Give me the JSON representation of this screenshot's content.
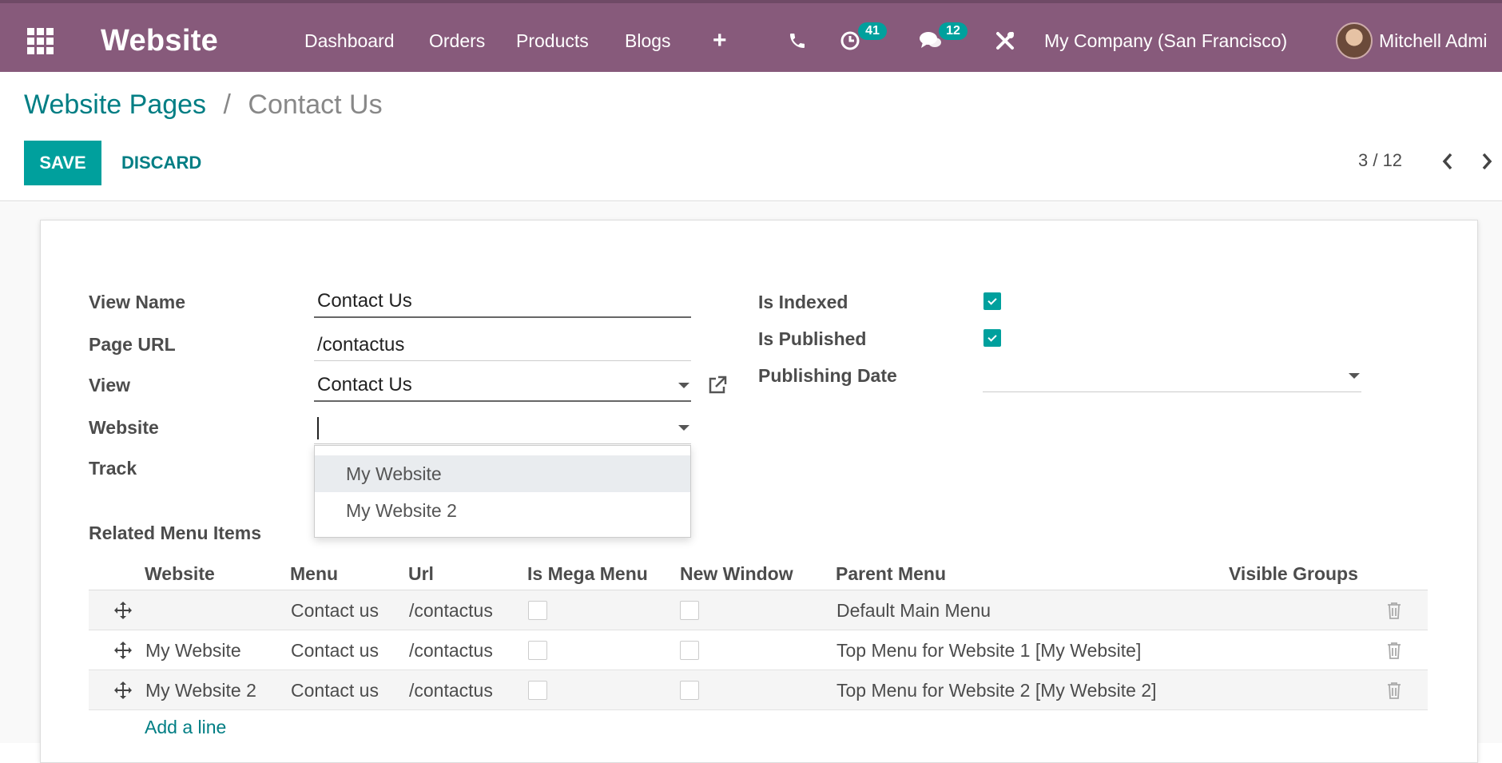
{
  "navbar": {
    "app_name": "Website",
    "menu": [
      "Dashboard",
      "Orders",
      "Products",
      "Blogs"
    ],
    "plus": "+",
    "activity_count": "41",
    "message_count": "12",
    "company": "My Company (San Francisco)",
    "user": "Mitchell Admi",
    "icons": [
      "apps-grid-icon",
      "phone-icon",
      "clock-icon",
      "chat-icon",
      "debug-tools-icon"
    ]
  },
  "breadcrumb": {
    "parent": "Website Pages",
    "separator": "/",
    "current": "Contact Us"
  },
  "actions": {
    "save": "SAVE",
    "discard": "DISCARD"
  },
  "pager": {
    "value": "3 / 12"
  },
  "form": {
    "labels": {
      "view_name": "View Name",
      "page_url": "Page URL",
      "view": "View",
      "website": "Website",
      "track": "Track",
      "is_indexed": "Is Indexed",
      "is_published": "Is Published",
      "publishing_date": "Publishing Date"
    },
    "values": {
      "view_name": "Contact Us",
      "page_url": "/contactus",
      "view": "Contact Us",
      "website": "",
      "publishing_date": "",
      "is_indexed": true,
      "is_published": true
    },
    "website_dropdown": [
      "My Website",
      "My Website 2"
    ]
  },
  "menu_items": {
    "title": "Related Menu Items",
    "columns": [
      "Website",
      "Menu",
      "Url",
      "Is Mega Menu",
      "New Window",
      "Parent Menu",
      "Visible Groups"
    ],
    "rows": [
      {
        "website": "",
        "menu": "Contact us",
        "url": "/contactus",
        "mega": false,
        "new_window": false,
        "parent": "Default Main Menu"
      },
      {
        "website": "My Website",
        "menu": "Contact us",
        "url": "/contactus",
        "mega": false,
        "new_window": false,
        "parent": "Top Menu for Website 1 [My Website]"
      },
      {
        "website": "My Website 2",
        "menu": "Contact us",
        "url": "/contactus",
        "mega": false,
        "new_window": false,
        "parent": "Top Menu for Website 2 [My Website 2]"
      }
    ],
    "add_line": "Add a line"
  },
  "colors": {
    "navbar": "#875a7b",
    "accent": "#00a09d",
    "link": "#017e84"
  }
}
